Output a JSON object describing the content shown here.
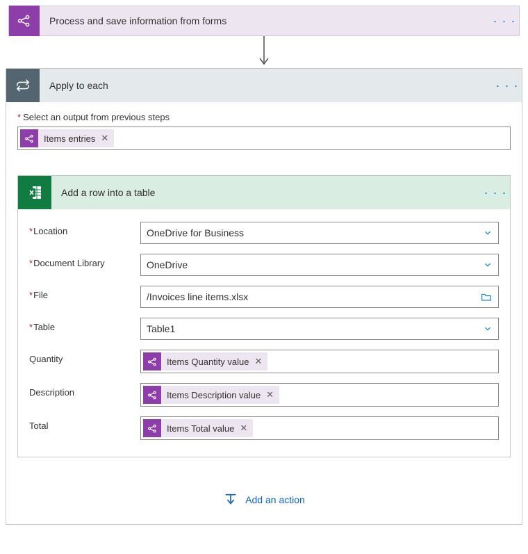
{
  "trigger": {
    "title": "Process and save information from forms"
  },
  "apply_to_each": {
    "title": "Apply to each",
    "output_label": "Select an output from previous steps",
    "output_token": "Items entries"
  },
  "action": {
    "title": "Add a row into a table",
    "fields": {
      "location": {
        "label": "Location",
        "value": "OneDrive for Business"
      },
      "doclib": {
        "label": "Document Library",
        "value": "OneDrive"
      },
      "file": {
        "label": "File",
        "value": "/Invoices line items.xlsx"
      },
      "table": {
        "label": "Table",
        "value": "Table1"
      },
      "quantity": {
        "label": "Quantity",
        "token": "Items Quantity value"
      },
      "description": {
        "label": "Description",
        "token": "Items Description value"
      },
      "total": {
        "label": "Total",
        "token": "Items Total value"
      }
    }
  },
  "add_action_label": "Add an action"
}
